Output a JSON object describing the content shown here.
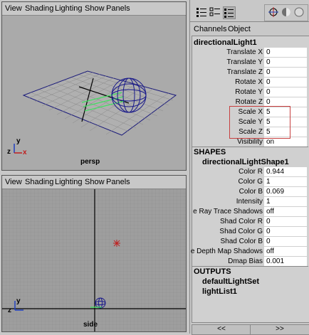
{
  "viewport_top": {
    "menus": [
      "View",
      "Shading",
      "Lighting",
      "Show",
      "Panels"
    ],
    "camera_label": "persp",
    "axis": {
      "y": "y",
      "z": "z",
      "x": "x"
    }
  },
  "viewport_bottom": {
    "menus": [
      "View",
      "Shading",
      "Lighting",
      "Show",
      "Panels"
    ],
    "camera_label": "side",
    "axis": {
      "y": "y",
      "z": "z"
    }
  },
  "channel_box": {
    "menus": [
      "Channels",
      "Object"
    ],
    "node_name": "directionalLight1",
    "transform_attrs": [
      {
        "label": "Translate X",
        "value": "0"
      },
      {
        "label": "Translate Y",
        "value": "0"
      },
      {
        "label": "Translate Z",
        "value": "0"
      },
      {
        "label": "Rotate X",
        "value": "0"
      },
      {
        "label": "Rotate Y",
        "value": "0"
      },
      {
        "label": "Rotate Z",
        "value": "0"
      },
      {
        "label": "Scale X",
        "value": "5"
      },
      {
        "label": "Scale Y",
        "value": "5"
      },
      {
        "label": "Scale Z",
        "value": "5"
      },
      {
        "label": "Visibility",
        "value": "on"
      }
    ],
    "shapes_header": "SHAPES",
    "shape_name": "directionalLightShape1",
    "shape_attrs": [
      {
        "label": "Color R",
        "value": "0.944"
      },
      {
        "label": "Color G",
        "value": "1"
      },
      {
        "label": "Color B",
        "value": "0.069"
      },
      {
        "label": "Intensity",
        "value": "1"
      },
      {
        "label": "e Ray Trace Shadows",
        "value": "off"
      },
      {
        "label": "Shad Color R",
        "value": "0"
      },
      {
        "label": "Shad Color G",
        "value": "0"
      },
      {
        "label": "Shad Color B",
        "value": "0"
      },
      {
        "label": "e Depth Map Shadows",
        "value": "off"
      },
      {
        "label": "Dmap Bias",
        "value": "0.001"
      }
    ],
    "outputs_header": "OUTPUTS",
    "outputs": [
      "defaultLightSet",
      "lightList1"
    ],
    "bottom_buttons": [
      "<<",
      ">>"
    ]
  },
  "colors": {
    "highlight_box": "#c84040",
    "light_sphere": "#1a1a8a",
    "selection_green": "#40e060",
    "light_marker": "#c02020"
  }
}
